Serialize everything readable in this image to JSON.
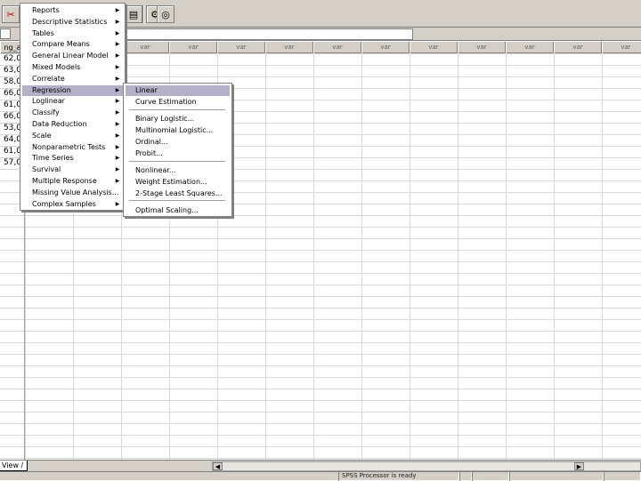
{
  "grid": {
    "column_headers": [
      "var",
      "var",
      "var",
      "var",
      "var",
      "var",
      "var",
      "var",
      "var",
      "var",
      "var",
      "var",
      "var"
    ],
    "rows": [
      "62,0",
      "63,0",
      "58,0",
      "66,0",
      "61,0",
      "66,0",
      "53,0",
      "64,0",
      "61,0",
      "57,0"
    ],
    "first_header_fragment": "ng_a"
  },
  "analyze_menu": {
    "items": [
      {
        "label": "Reports",
        "submenu": true
      },
      {
        "label": "Descriptive Statistics",
        "submenu": true
      },
      {
        "label": "Tables",
        "submenu": true
      },
      {
        "label": "Compare Means",
        "submenu": true
      },
      {
        "label": "General Linear Model",
        "submenu": true
      },
      {
        "label": "Mixed Models",
        "submenu": true
      },
      {
        "label": "Correlate",
        "submenu": true
      },
      {
        "label": "Regression",
        "submenu": true
      },
      {
        "label": "Loglinear",
        "submenu": true
      },
      {
        "label": "Classify",
        "submenu": true
      },
      {
        "label": "Data Reduction",
        "submenu": true
      },
      {
        "label": "Scale",
        "submenu": true
      },
      {
        "label": "Nonparametric Tests",
        "submenu": true
      },
      {
        "label": "Time Series",
        "submenu": true
      },
      {
        "label": "Survival",
        "submenu": true
      },
      {
        "label": "Multiple Response",
        "submenu": true
      },
      {
        "label": "Missing Value Analysis...",
        "submenu": false
      },
      {
        "label": "Complex Samples",
        "submenu": true
      }
    ],
    "highlighted": "Regression"
  },
  "regression_submenu": {
    "items": [
      {
        "label": "Linear"
      },
      {
        "label": "Curve Estimation"
      },
      {
        "label": "Binary Logistic..."
      },
      {
        "label": "Multinomial Logistic..."
      },
      {
        "label": "Ordinal..."
      },
      {
        "label": "Probit..."
      },
      {
        "label": "Nonlinear..."
      },
      {
        "label": "Weight Estimation..."
      },
      {
        "label": "2-Stage Least Squares..."
      },
      {
        "label": "Optimal Scaling..."
      }
    ],
    "highlighted": "Linear"
  },
  "tabs": {
    "view_tab": "View"
  },
  "status": {
    "processor": "SPSS Processor  is ready"
  },
  "icons": [
    "cut-icon",
    "find-icon",
    "use-sets-icon",
    "show-all-icon"
  ]
}
